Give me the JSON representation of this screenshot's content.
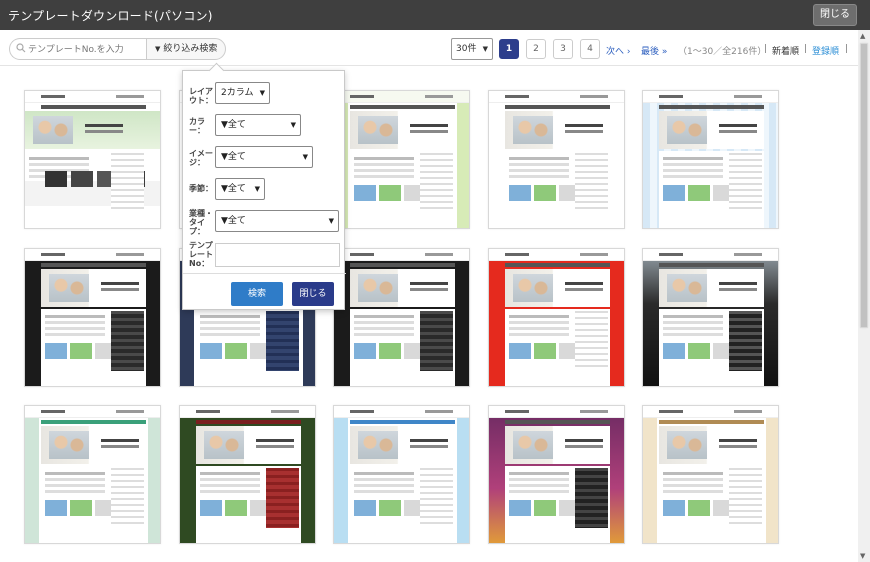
{
  "window": {
    "title": "テンプレートダウンロード(パソコン)",
    "close_label": "閉じる"
  },
  "toolbar": {
    "search_placeholder": "テンプレートNo.を入力",
    "filter_label": "絞り込み検索",
    "per_page": "30件",
    "pages": [
      "1",
      "2",
      "3",
      "4"
    ],
    "current_page": "1",
    "next_label": "次へ ›",
    "last_label": "最後 »",
    "count_text": "（1～30／全216件）",
    "separator": "|",
    "sort_newest": "新着順",
    "sort_registered": "登録順"
  },
  "filter_popup": {
    "layout_label": "レイアウト：",
    "layout_value": "2カラム",
    "color_label": "カラー：",
    "color_value": "▼全て",
    "image_label": "イメージ：",
    "image_value": "▼全て",
    "season_label": "季節：",
    "season_value": "▼全て",
    "industry_label": "業種・タイプ：",
    "industry_value": "▼全て",
    "template_no_label": "テンプレートNo：",
    "template_no_value": "",
    "search_button": "検索",
    "close_button": "閉じる"
  },
  "templates": [
    {
      "variant": "first",
      "color": "#cfe6c6"
    },
    {
      "variant": "clean",
      "color": "#ffffff"
    },
    {
      "variant": "green",
      "color": "#d7ebb7"
    },
    {
      "variant": "clean",
      "color": "#ffffff"
    },
    {
      "variant": "stripe",
      "color": "#d6e8f6"
    },
    {
      "variant": "black",
      "color": "#1b1b1b"
    },
    {
      "variant": "navy",
      "color": "#2e3a58"
    },
    {
      "variant": "black",
      "color": "#1b1b1b"
    },
    {
      "variant": "red",
      "color": "#e52a1e"
    },
    {
      "variant": "dark",
      "color": "#111111"
    },
    {
      "variant": "mint",
      "color": "#cfe5d8"
    },
    {
      "variant": "forest",
      "color": "#2f4a22"
    },
    {
      "variant": "sky",
      "color": "#b9def2"
    },
    {
      "variant": "purple",
      "color": "#6b2a62"
    },
    {
      "variant": "beige",
      "color": "#f1e4c9"
    }
  ],
  "icons": {
    "search": "search-icon",
    "caret": "caret-down-icon"
  },
  "colors": {
    "title_bar": "#3f3f3f",
    "active_page": "#2d3e8c",
    "search_button": "#2f7cc8",
    "close_button": "#2a3b8a",
    "link": "#2d5fbf"
  }
}
